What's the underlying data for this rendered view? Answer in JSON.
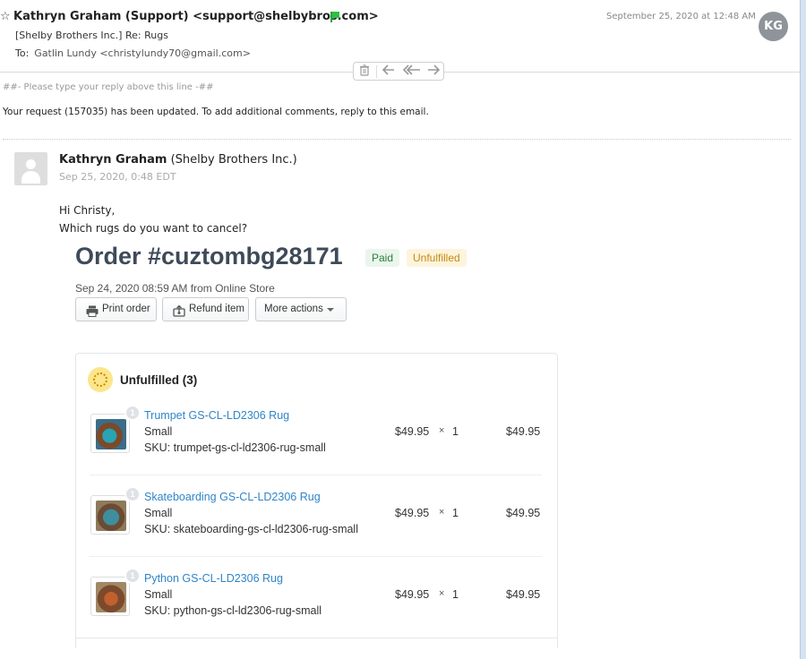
{
  "header": {
    "star_icon": "star-outline-icon",
    "from": "Kathryn Graham (Support) <support@shelbybros.com>",
    "flag_color": "#2fbf44",
    "subject": "[Shelby Brothers Inc.] Re: Rugs",
    "to_label": "To:",
    "to_value": "Gatlin Lundy <christylundy70@gmail.com>",
    "date": "September 25, 2020 at 12:48 AM",
    "avatar_initials": "KG"
  },
  "actions": {
    "icons": [
      "trash-icon",
      "reply-icon",
      "reply-all-icon",
      "forward-icon"
    ]
  },
  "body": {
    "reply_line": "##- Please type your reply above this line -##",
    "update_line": "Your request (157035) has been updated. To add additional comments, reply to this email."
  },
  "message": {
    "author_name": "Kathryn Graham",
    "author_org": "(Shelby Brothers Inc.)",
    "date": "Sep 25, 2020, 0:48 EDT",
    "greeting": "Hi Christy,",
    "question": "Which rugs do you want to cancel?"
  },
  "order": {
    "title": "Order #cuztombg28171",
    "badge_paid": "Paid",
    "badge_unfulfilled": "Unfulfilled",
    "meta": "Sep 24, 2020 08:59 AM from Online Store",
    "btn_print": "Print order",
    "btn_refund": "Refund item",
    "btn_more": "More actions",
    "section_title": "Unfulfilled (3)",
    "items": [
      {
        "name": "Trumpet GS-CL-LD2306 Rug",
        "variant": "Small",
        "sku": "SKU: trumpet-gs-cl-ld2306-rug-small",
        "price": "$49.95",
        "times": "×",
        "qty": "1",
        "total": "$49.95",
        "badge": "1"
      },
      {
        "name": "Skateboarding GS-CL-LD2306 Rug",
        "variant": "Small",
        "sku": "SKU: skateboarding-gs-cl-ld2306-rug-small",
        "price": "$49.95",
        "times": "×",
        "qty": "1",
        "total": "$49.95",
        "badge": "1"
      },
      {
        "name": "Python GS-CL-LD2306 Rug",
        "variant": "Small",
        "sku": "SKU: python-gs-cl-ld2306-rug-small",
        "price": "$49.95",
        "times": "×",
        "qty": "1",
        "total": "$49.95",
        "badge": "1"
      }
    ]
  },
  "colors": {
    "link": "#2f85c8",
    "paid_text": "#2e7d3a",
    "unfulfilled_text": "#c58a14",
    "avatar_bg": "#8f949b"
  }
}
